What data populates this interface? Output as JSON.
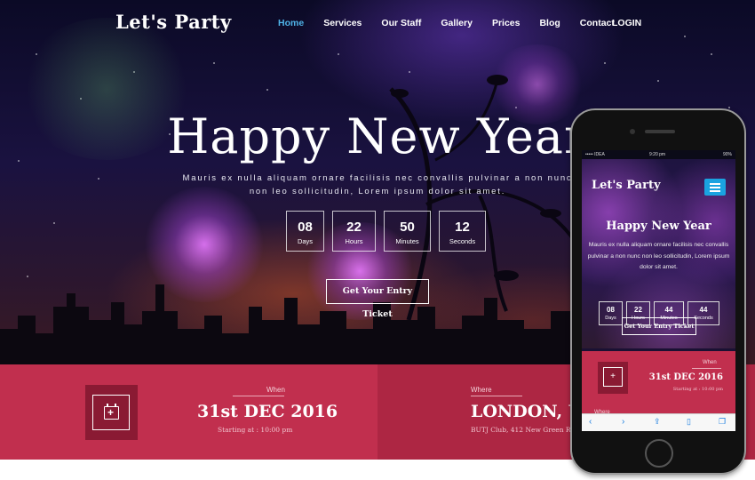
{
  "site": {
    "logo": "Let's Party",
    "nav": [
      "Home",
      "Services",
      "Our Staff",
      "Gallery",
      "Prices",
      "Blog",
      "Contact"
    ],
    "active_nav": "Home",
    "login": "LOGIN"
  },
  "hero": {
    "title": "Happy New Year",
    "subtitle_line1": "Mauris ex nulla aliquam ornare facilisis nec convallis pulvinar a non nunc",
    "subtitle_line2": "non leo sollicitudin, Lorem ipsum dolor sit amet.",
    "countdown": [
      {
        "value": "08",
        "label": "Days"
      },
      {
        "value": "22",
        "label": "Hours"
      },
      {
        "value": "50",
        "label": "Minutes"
      },
      {
        "value": "12",
        "label": "Seconds"
      }
    ],
    "ticket_button": "Get Your Entry Ticket"
  },
  "info": {
    "when_label": "When",
    "when_value": "31st DEC 2016",
    "when_sub": "Starting at : 10:00 pm",
    "where_label": "Where",
    "where_value": "LONDON, UK",
    "where_sub": "BUTJ Club, 412 New Green Road"
  },
  "phone": {
    "status_left": "••••• IDEA",
    "status_time": "9:20 pm",
    "status_right": "90%",
    "logo": "Let's Party",
    "title": "Happy New Year",
    "text_lines": [
      "Mauris ex nulla aliquam ornare facilisis nec convallis",
      "pulvinar a non nunc non leo sollicitudin, Lorem ipsum",
      "dolor sit amet."
    ],
    "countdown": [
      {
        "value": "08",
        "label": "Days"
      },
      {
        "value": "22",
        "label": "Hours"
      },
      {
        "value": "44",
        "label": "Minutes"
      },
      {
        "value": "44",
        "label": "Seconds"
      }
    ],
    "ticket_button": "Get Your Entry Ticket",
    "when_label": "When",
    "when_value": "31st DEC 2016",
    "when_sub": "Starting at : 10:00 pm",
    "where_label": "Where"
  },
  "colors": {
    "accent": "#4fb3e8",
    "band_left": "#c12f4e",
    "band_right": "#ad2643",
    "icon_box": "#8a1a33"
  }
}
